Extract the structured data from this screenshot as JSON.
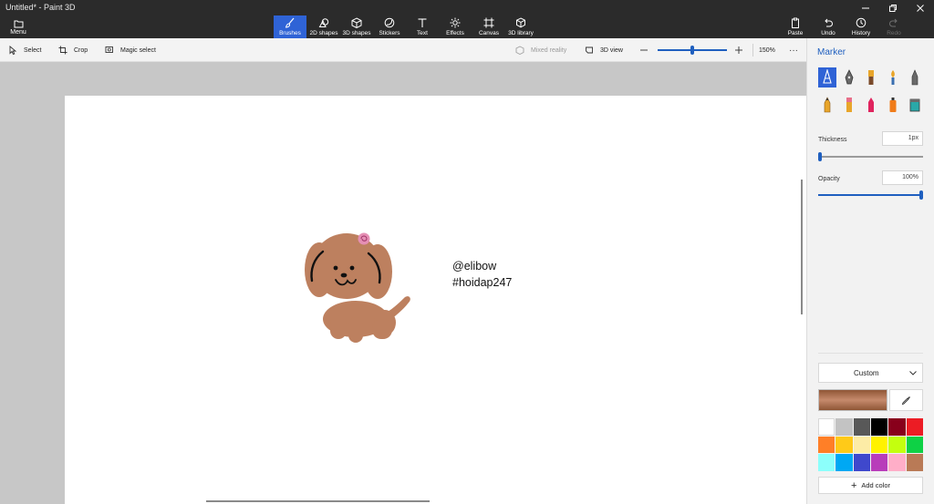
{
  "window": {
    "title": "Untitled* - Paint 3D"
  },
  "ribbon": {
    "menu_label": "Menu",
    "tabs": [
      {
        "label": "Brushes",
        "icon": "brush-icon",
        "active": true
      },
      {
        "label": "2D shapes",
        "icon": "2d-shapes-icon"
      },
      {
        "label": "3D shapes",
        "icon": "3d-shapes-icon"
      },
      {
        "label": "Stickers",
        "icon": "stickers-icon"
      },
      {
        "label": "Text",
        "icon": "text-icon"
      },
      {
        "label": "Effects",
        "icon": "effects-icon"
      },
      {
        "label": "Canvas",
        "icon": "canvas-icon"
      },
      {
        "label": "3D library",
        "icon": "3d-library-icon"
      }
    ],
    "actions": [
      {
        "label": "Paste",
        "icon": "paste-icon"
      },
      {
        "label": "Undo",
        "icon": "undo-icon"
      },
      {
        "label": "History",
        "icon": "history-icon"
      },
      {
        "label": "Redo",
        "icon": "redo-icon",
        "disabled": true
      }
    ]
  },
  "toolbar": {
    "select_label": "Select",
    "crop_label": "Crop",
    "magic_select_label": "Magic select",
    "mixed_reality_label": "Mixed reality",
    "view_3d_label": "3D view",
    "zoom_value": "150%",
    "zoom_level": 0.5,
    "more_label": "···"
  },
  "canvas": {
    "text_line1": "@elibow",
    "text_line2": "#hoidap247",
    "dog_color": "#bd805f",
    "bow_color": "#e58fb4"
  },
  "panel": {
    "title": "Marker",
    "brushes": [
      {
        "name": "marker-brush-icon",
        "active": true
      },
      {
        "name": "calligraphy-pen-icon"
      },
      {
        "name": "oil-brush-icon"
      },
      {
        "name": "watercolor-brush-icon"
      },
      {
        "name": "pixel-pen-icon"
      },
      {
        "name": "pencil-icon"
      },
      {
        "name": "eraser-icon"
      },
      {
        "name": "crayon-icon"
      },
      {
        "name": "spray-can-icon"
      },
      {
        "name": "fill-bucket-icon"
      }
    ],
    "thickness_label": "Thickness",
    "thickness_value": "1px",
    "thickness_level": 0.0,
    "opacity_label": "Opacity",
    "opacity_value": "100%",
    "opacity_level": 1.0,
    "color_mode": "Custom",
    "current_color": "#c68a6c",
    "add_color_label": "Add color",
    "swatches": [
      "#ffffff",
      "#c3c3c3",
      "#585858",
      "#000000",
      "#88001b",
      "#ec1c24",
      "#ff7f27",
      "#ffca18",
      "#fdeca6",
      "#fff200",
      "#c4ff0e",
      "#0ed145",
      "#8cfffb",
      "#00a8f3",
      "#3f48cc",
      "#b83dba",
      "#ffaec8",
      "#b97a56"
    ]
  }
}
